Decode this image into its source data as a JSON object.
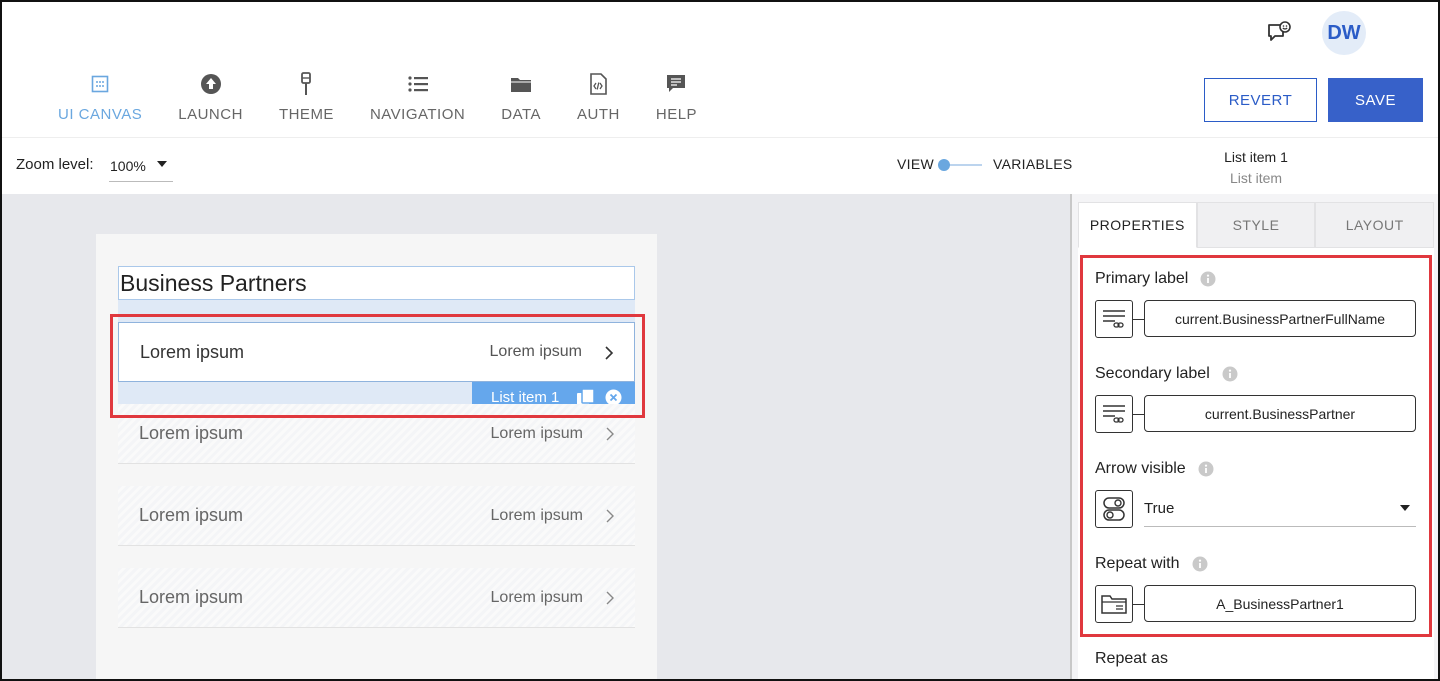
{
  "header": {
    "avatar_initials": "DW",
    "nav": [
      {
        "label": "UI CANVAS",
        "icon": "ui-canvas-icon",
        "active": true
      },
      {
        "label": "LAUNCH",
        "icon": "launch-icon"
      },
      {
        "label": "THEME",
        "icon": "theme-icon"
      },
      {
        "label": "NAVIGATION",
        "icon": "navigation-icon"
      },
      {
        "label": "DATA",
        "icon": "data-folder-icon"
      },
      {
        "label": "AUTH",
        "icon": "auth-file-icon"
      },
      {
        "label": "HELP",
        "icon": "help-chat-icon"
      }
    ],
    "revert_label": "REVERT",
    "save_label": "SAVE"
  },
  "toolbar": {
    "zoom_label": "Zoom level:",
    "zoom_value": "100%",
    "view_label": "VIEW",
    "variables_label": "VARIABLES",
    "selected_title": "List item 1",
    "selected_type": "List item"
  },
  "canvas": {
    "page_title": "Business Partners",
    "items": [
      {
        "primary": "Lorem ipsum",
        "secondary": "Lorem ipsum"
      },
      {
        "primary": "Lorem ipsum",
        "secondary": "Lorem ipsum"
      },
      {
        "primary": "Lorem ipsum",
        "secondary": "Lorem ipsum"
      },
      {
        "primary": "Lorem ipsum",
        "secondary": "Lorem ipsum"
      }
    ],
    "selected_badge": "List item 1"
  },
  "panel": {
    "tabs": [
      "PROPERTIES",
      "STYLE",
      "LAYOUT"
    ],
    "active_tab": "PROPERTIES",
    "primary_label": {
      "label": "Primary label",
      "value": "current.BusinessPartnerFullName"
    },
    "secondary_label": {
      "label": "Secondary label",
      "value": "current.BusinessPartner"
    },
    "arrow_visible": {
      "label": "Arrow visible",
      "value": "True"
    },
    "repeat_with": {
      "label": "Repeat with",
      "value": "A_BusinessPartner1"
    },
    "repeat_as": {
      "label": "Repeat as"
    }
  },
  "colors": {
    "accent": "#3761c9",
    "active_nav": "#6aa7df",
    "highlight": "#e0383e",
    "badge": "#65a7ec"
  }
}
